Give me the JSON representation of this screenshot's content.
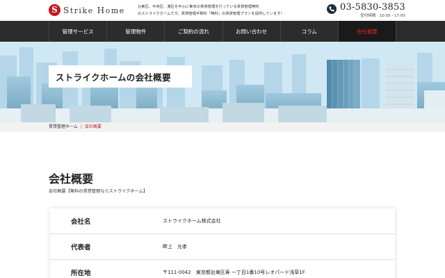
{
  "header": {
    "logo_mark": "S",
    "logo_text_s": "S",
    "logo_text_rest": "trike ",
    "logo_text_h": "H",
    "logo_text_rest2": "ome",
    "tagline_line1": "台東区、中央区、港区を中心に東京の賃貸管理を行っている賃貸管理無料",
    "tagline_line2": "のストライクホームです。賃貸管理手数料「無料」の賃貸管理プランを提供しています！",
    "phone_number": "03-5830-3853",
    "hours": "受付時間　10:00 - 17:00"
  },
  "nav": {
    "items": [
      {
        "label": "管理サービス"
      },
      {
        "label": "管理物件"
      },
      {
        "label": "ご契約の流れ"
      },
      {
        "label": "お問い合わせ"
      },
      {
        "label": "コラム"
      },
      {
        "label": "会社概要"
      }
    ],
    "active_color": "#e4261e"
  },
  "hero": {
    "title": "ストライクホームの会社概要"
  },
  "breadcrumb": {
    "home": "賃貸管理ホーム",
    "separator": "/",
    "current": "会社概要"
  },
  "section": {
    "title": "会社概要",
    "subtitle": "会社概要【無料の賃貸管理ならストライクホーム】"
  },
  "company_table": {
    "rows": [
      {
        "label": "会社名",
        "value": "ストライクホーム株式会社"
      },
      {
        "label": "代表者",
        "value": "畔上　允孝"
      },
      {
        "label": "所在地",
        "value": "〒111-0042　東京都台東区寿 一丁目1番10号レオパード浅草1F"
      }
    ]
  },
  "colors": {
    "brand_red": "#c4161c",
    "nav_bg": "#2c2c2c"
  }
}
